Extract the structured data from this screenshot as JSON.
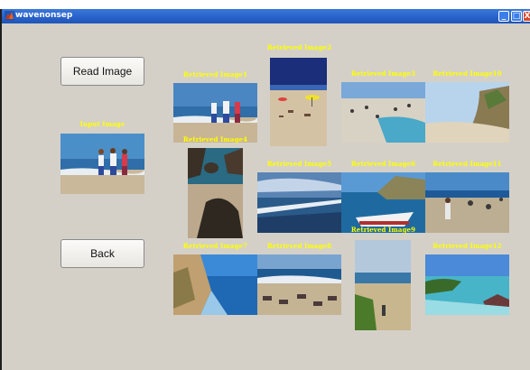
{
  "window": {
    "title": "wavenonsep",
    "controls": {
      "minimize": "_",
      "maximize": "□",
      "close": "X"
    }
  },
  "buttons": {
    "read_image": "Read Image",
    "back": "Back"
  },
  "input": {
    "caption": "Input Image"
  },
  "retrieved": [
    {
      "caption": "Retrieved Image1"
    },
    {
      "caption": "Retrieved Image2"
    },
    {
      "caption": "Retrieved Image3"
    },
    {
      "caption": "Retrieved Image10"
    },
    {
      "caption": "Retrieved Image4"
    },
    {
      "caption": "Retrieved Image5"
    },
    {
      "caption": "Retrieved Image6"
    },
    {
      "caption": "Retrieved Image11"
    },
    {
      "caption": "Retrieved Image7"
    },
    {
      "caption": "Retrieved Image8"
    },
    {
      "caption": "Retrieved Image9"
    },
    {
      "caption": "Retrieved Image12"
    }
  ]
}
